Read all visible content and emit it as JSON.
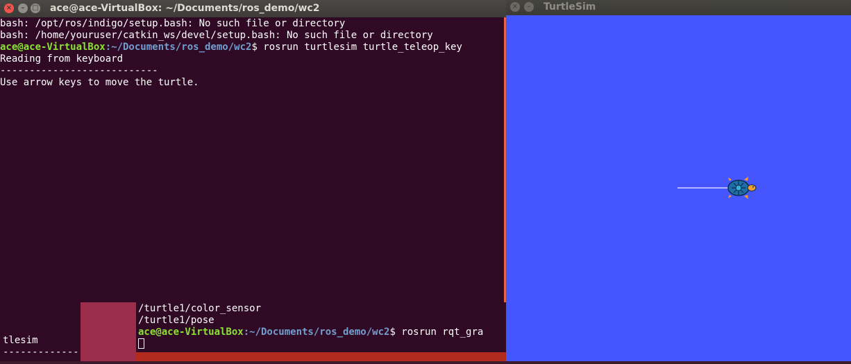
{
  "terminal": {
    "title": "ace@ace-VirtualBox: ~/Documents/ros_demo/wc2",
    "buttons": {
      "close": "×",
      "minimize": "–",
      "maximize": "□"
    },
    "lines": {
      "error1": "bash: /opt/ros/indigo/setup.bash: No such file or directory",
      "error2": "bash: /home/youruser/catkin_ws/devel/setup.bash: No such file or directory",
      "prompt_user": "ace@ace-VirtualBox",
      "prompt_path": ":~/Documents/ros_demo/wc2",
      "prompt_cmd": "$ rosrun turtlesim turtle_teleop_key",
      "reading": "Reading from keyboard",
      "separator": "---------------------------",
      "instruction": "Use arrow keys to move the turtle."
    }
  },
  "bottom_left_terminal": {
    "line1": "tlesim",
    "line2": "-------------"
  },
  "bottom_terminal": {
    "line1": "/turtle1/color_sensor",
    "line2": "/turtle1/pose",
    "prompt_user": "ace@ace-VirtualBox",
    "prompt_path": ":~/Documents/ros_demo/wc2",
    "prompt_cmd": "$ rosrun rqt_gra"
  },
  "turtlesim": {
    "title": "TurtleSim",
    "buttons": {
      "close": "×",
      "minimize": "–"
    },
    "background_color": "#4556ff",
    "trail_color": "#b3b8ff"
  }
}
